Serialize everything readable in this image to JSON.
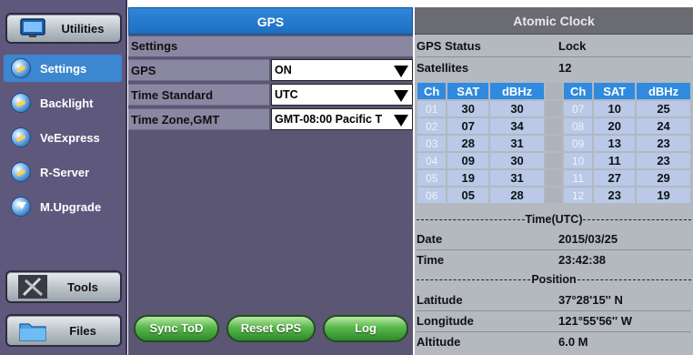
{
  "sidebar": {
    "utilities_label": "Utilities",
    "items": [
      {
        "label": "Settings",
        "active": true
      },
      {
        "label": "Backlight",
        "active": false
      },
      {
        "label": "VeExpress",
        "active": false
      },
      {
        "label": "R-Server",
        "active": false
      },
      {
        "label": "M.Upgrade",
        "active": false
      }
    ],
    "tools_label": "Tools",
    "files_label": "Files"
  },
  "gps_panel": {
    "title": "GPS",
    "settings_title": "Settings",
    "rows": [
      {
        "label": "GPS",
        "value": "ON"
      },
      {
        "label": "Time Standard",
        "value": "UTC"
      },
      {
        "label": "Time Zone,GMT",
        "value": "GMT-08:00 Pacific T"
      }
    ],
    "buttons": {
      "sync": "Sync ToD",
      "reset": "Reset GPS",
      "log": "Log"
    }
  },
  "clock_panel": {
    "title": "Atomic Clock",
    "gps_status_label": "GPS Status",
    "gps_status_value": "Lock",
    "satellites_label": "Satellites",
    "satellites_value": "12",
    "table_headers": [
      "Ch",
      "SAT",
      "dBHz",
      "Ch",
      "SAT",
      "dBHz"
    ],
    "table_rows": [
      [
        "01",
        "30",
        "30",
        "07",
        "10",
        "25"
      ],
      [
        "02",
        "07",
        "34",
        "08",
        "20",
        "24"
      ],
      [
        "03",
        "28",
        "31",
        "09",
        "13",
        "23"
      ],
      [
        "04",
        "09",
        "30",
        "10",
        "11",
        "23"
      ],
      [
        "05",
        "19",
        "31",
        "11",
        "27",
        "29"
      ],
      [
        "06",
        "05",
        "28",
        "12",
        "23",
        "19"
      ]
    ],
    "time_divider": "Time(UTC)",
    "date_label": "Date",
    "date_value": "2015/03/25",
    "time_label": "Time",
    "time_value": "23:42:38",
    "position_divider": "Position",
    "latitude_label": "Latitude",
    "latitude_value": "37°28'15'' N",
    "longitude_label": "Longitude",
    "longitude_value": "121°55'56'' W",
    "altitude_label": "Altitude",
    "altitude_value": "6.0 M"
  },
  "colors": {
    "header_blue": "#1e6fc2",
    "button_green": "#58b84a",
    "sidebar_purple": "#5f587d",
    "table_header_blue": "#2f8ae0"
  }
}
